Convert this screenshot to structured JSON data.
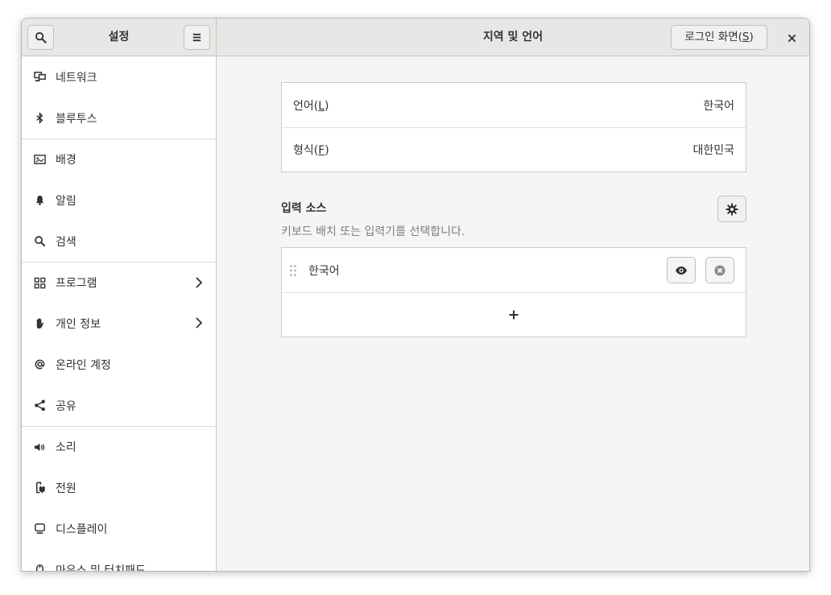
{
  "header": {
    "sidebar_title": "설정",
    "main_title": "지역 및 언어",
    "login_screen_button": "로그인 화면",
    "login_screen_mnemonic": "S"
  },
  "sidebar": {
    "items": [
      {
        "label": "네트워크",
        "icon": "network-icon"
      },
      {
        "label": "블루투스",
        "icon": "bluetooth-icon"
      },
      {
        "label": "배경",
        "icon": "background-icon"
      },
      {
        "label": "알림",
        "icon": "bell-icon"
      },
      {
        "label": "검색",
        "icon": "search-icon"
      },
      {
        "label": "프로그램",
        "icon": "apps-grid-icon"
      },
      {
        "label": "개인 정보",
        "icon": "hand-icon"
      },
      {
        "label": "온라인 계정",
        "icon": "at-icon"
      },
      {
        "label": "공유",
        "icon": "share-icon"
      },
      {
        "label": "소리",
        "icon": "speaker-icon"
      },
      {
        "label": "전원",
        "icon": "power-icon"
      },
      {
        "label": "디스플레이",
        "icon": "display-icon"
      },
      {
        "label": "마우스 및 터치패드",
        "icon": "mouse-icon"
      }
    ]
  },
  "language_box": {
    "language_label": "언어",
    "language_mnemonic": "L",
    "language_value": "한국어",
    "formats_label": "형식",
    "formats_mnemonic": "F",
    "formats_value": "대한민국"
  },
  "input_sources": {
    "title": "입력 소스",
    "subtitle": "키보드 배치 또는 입력기를 선택합니다.",
    "items": [
      {
        "label": "한국어"
      }
    ],
    "add_label": "+"
  }
}
